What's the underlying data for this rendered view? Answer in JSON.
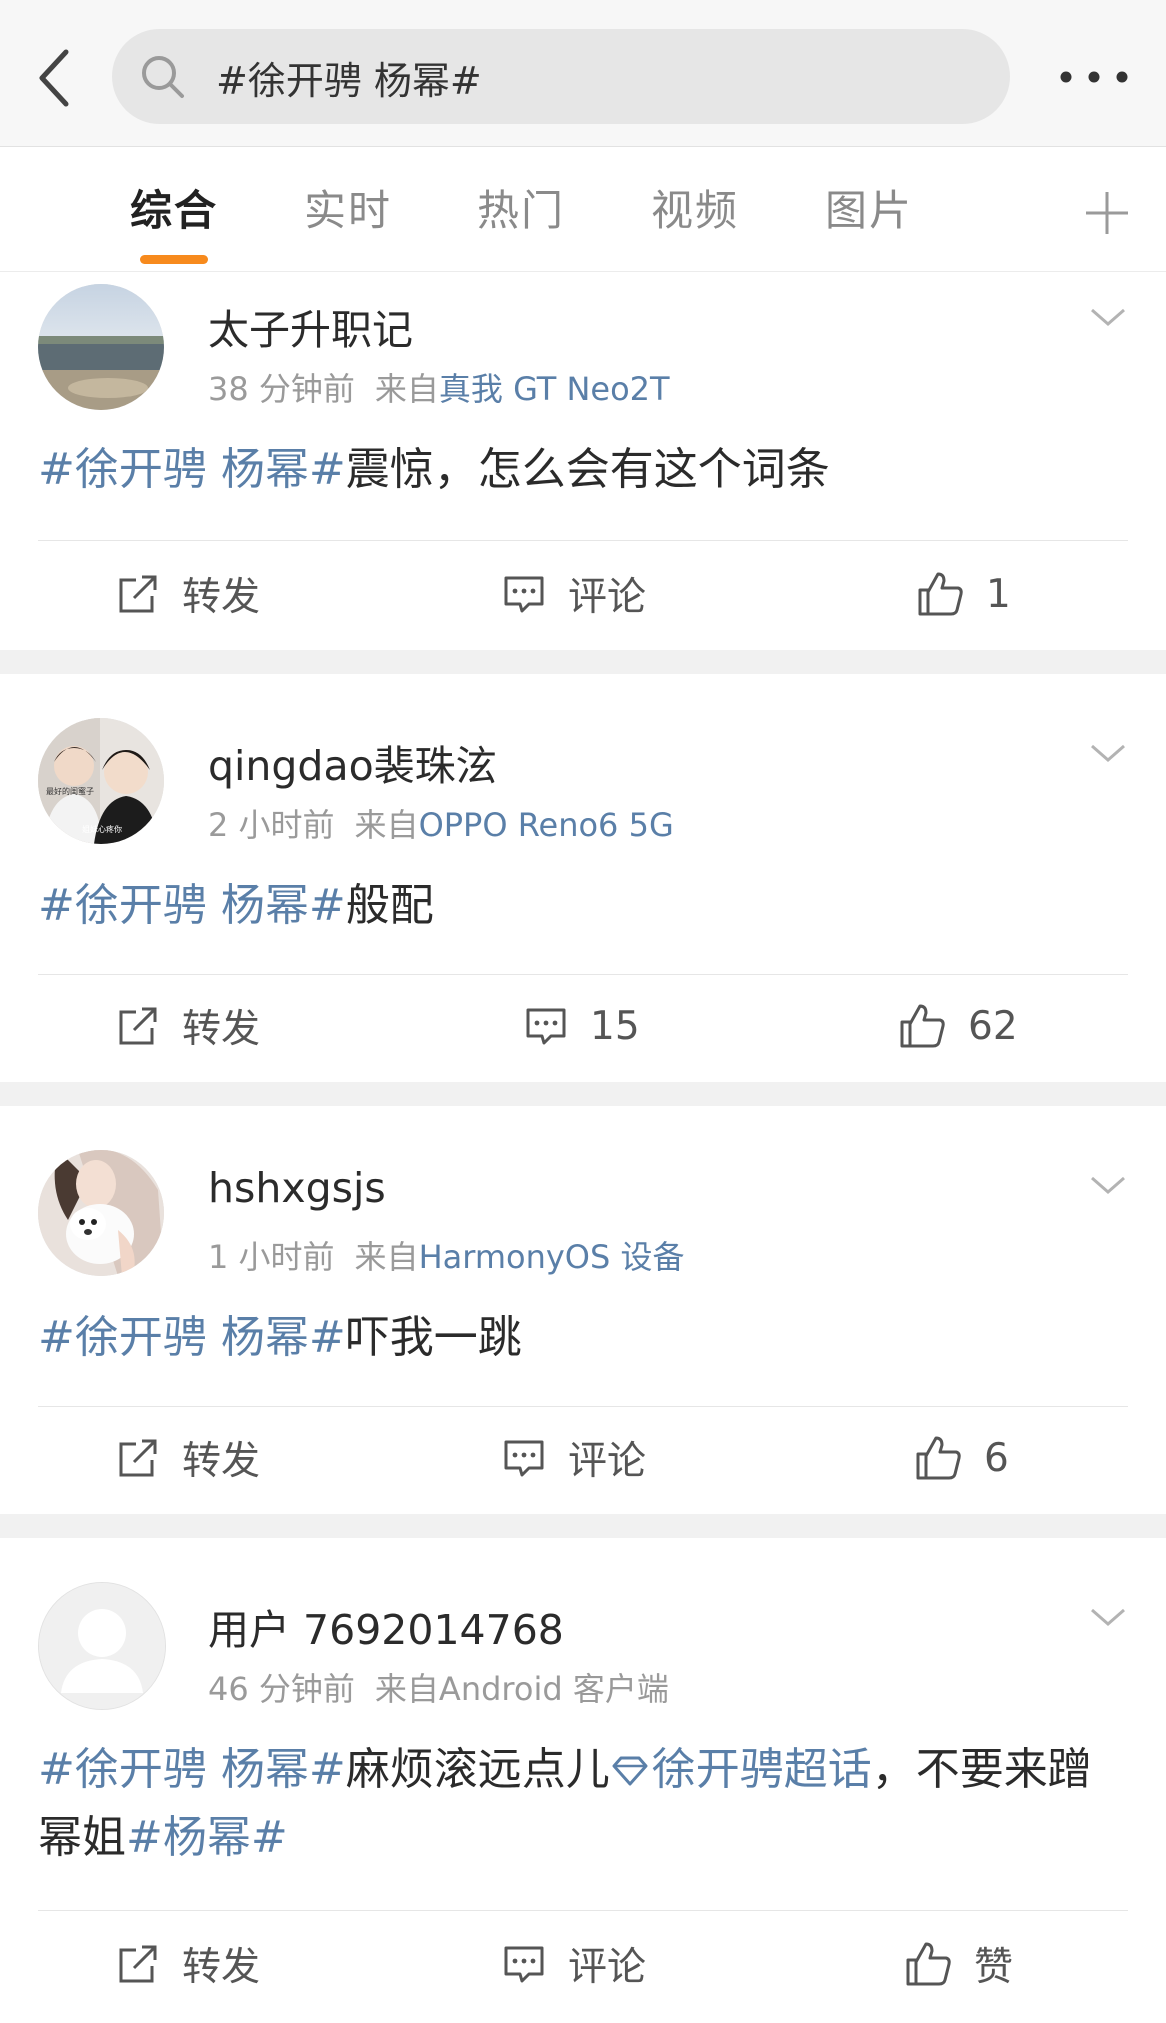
{
  "header": {
    "search_value": "#徐开骋 杨幂#",
    "back_icon": "chevron-left-icon",
    "more_icon": "more-dots-icon"
  },
  "tabs": [
    "综合",
    "实时",
    "热门",
    "视频",
    "图片"
  ],
  "colors": {
    "accent": "#f78a1d",
    "link": "#5a7fa8",
    "separator": "#f1f1f1"
  },
  "posts": [
    {
      "username": "太子升职记",
      "time": "38 分钟前",
      "from": "来自",
      "source": "真我 GT Neo2T",
      "text": [
        {
          "type": "tag",
          "value": "#徐开骋 杨幂#"
        },
        {
          "type": "text",
          "value": "震惊，怎么会有这个词条"
        }
      ],
      "repost": "转发",
      "comment": "评论",
      "like": "1"
    },
    {
      "username": "qingdao裴珠泫",
      "time": "2 小时前",
      "from": "来自",
      "source": "OPPO Reno6 5G",
      "avatar_text_1": "最好的闺蜜子",
      "avatar_text_2": "姐妹心疼你",
      "text": [
        {
          "type": "tag",
          "value": "#徐开骋 杨幂#"
        },
        {
          "type": "text",
          "value": "般配"
        }
      ],
      "repost": "转发",
      "comment": "15",
      "like": "62"
    },
    {
      "username": "hshxgsjs",
      "time": "1 小时前",
      "from": "来自",
      "source": "HarmonyOS 设备",
      "text": [
        {
          "type": "tag",
          "value": "#徐开骋 杨幂#"
        },
        {
          "type": "text",
          "value": "吓我一跳"
        }
      ],
      "repost": "转发",
      "comment": "评论",
      "like": "6"
    },
    {
      "username": "用户 7692014768",
      "time": "46 分钟前",
      "from": "来自",
      "source": "Android 客户端",
      "text": [
        {
          "type": "tag",
          "value": "#徐开骋 杨幂#"
        },
        {
          "type": "text",
          "value": "麻烦滚远点儿"
        },
        {
          "type": "supertopic",
          "value": "徐开骋超话"
        },
        {
          "type": "text",
          "value": "，不要来蹭幂姐"
        },
        {
          "type": "tag",
          "value": "#杨幂#"
        }
      ],
      "repost": "转发",
      "comment": "评论",
      "like": "赞"
    }
  ]
}
